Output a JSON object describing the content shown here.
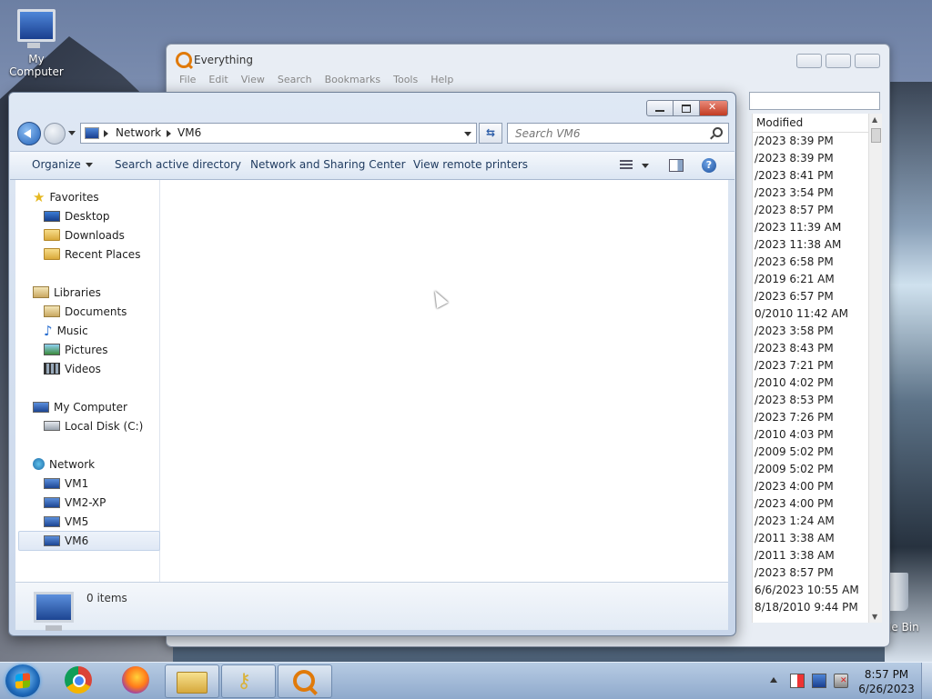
{
  "desktop": {
    "icons": [
      {
        "label": "My Computer"
      },
      {
        "label": "le Bin"
      }
    ]
  },
  "everything": {
    "title": "Everything",
    "menu": [
      "File",
      "Edit",
      "View",
      "Search",
      "Bookmarks",
      "Tools",
      "Help"
    ],
    "column_header": "Modified",
    "dates": [
      "/2023 8:39 PM",
      "/2023 8:39 PM",
      "/2023 8:41 PM",
      "/2023 3:54 PM",
      "/2023 8:57 PM",
      "/2023 11:39 AM",
      "/2023 11:38 AM",
      "/2023 6:58 PM",
      "/2019 6:21 AM",
      "/2023 6:57 PM",
      "0/2010 11:42 AM",
      "/2023 3:58 PM",
      "/2023 8:43 PM",
      "/2023 7:21 PM",
      "/2010 4:02 PM",
      "/2023 8:53 PM",
      "/2023 7:26 PM",
      "/2010 4:03 PM",
      "/2009 5:02 PM",
      "/2009 5:02 PM",
      "/2023 4:00 PM",
      "/2023 4:00 PM",
      "/2023 1:24 AM",
      "/2011 3:38 AM",
      "/2011 3:38 AM",
      "/2023 8:57 PM",
      "6/6/2023 10:55 AM",
      "8/18/2010 9:44 PM"
    ]
  },
  "explorer": {
    "breadcrumb": [
      "Network",
      "VM6"
    ],
    "search_placeholder": "Search VM6",
    "toolbar": {
      "organize": "Organize",
      "search_ad": "Search active directory",
      "network_center": "Network and Sharing Center",
      "remote_printers": "View remote printers",
      "help": "?"
    },
    "nav": {
      "favorites": "Favorites",
      "desktop": "Desktop",
      "downloads": "Downloads",
      "recent": "Recent Places",
      "libraries": "Libraries",
      "documents": "Documents",
      "music": "Music",
      "pictures": "Pictures",
      "videos": "Videos",
      "my_computer": "My Computer",
      "local_disk": "Local Disk (C:)",
      "network": "Network",
      "vm1": "VM1",
      "vm2": "VM2-XP",
      "vm5": "VM5",
      "vm6": "VM6"
    },
    "status": "0 items"
  },
  "taskbar": {
    "time": "8:57 PM",
    "date": "6/26/2023"
  }
}
